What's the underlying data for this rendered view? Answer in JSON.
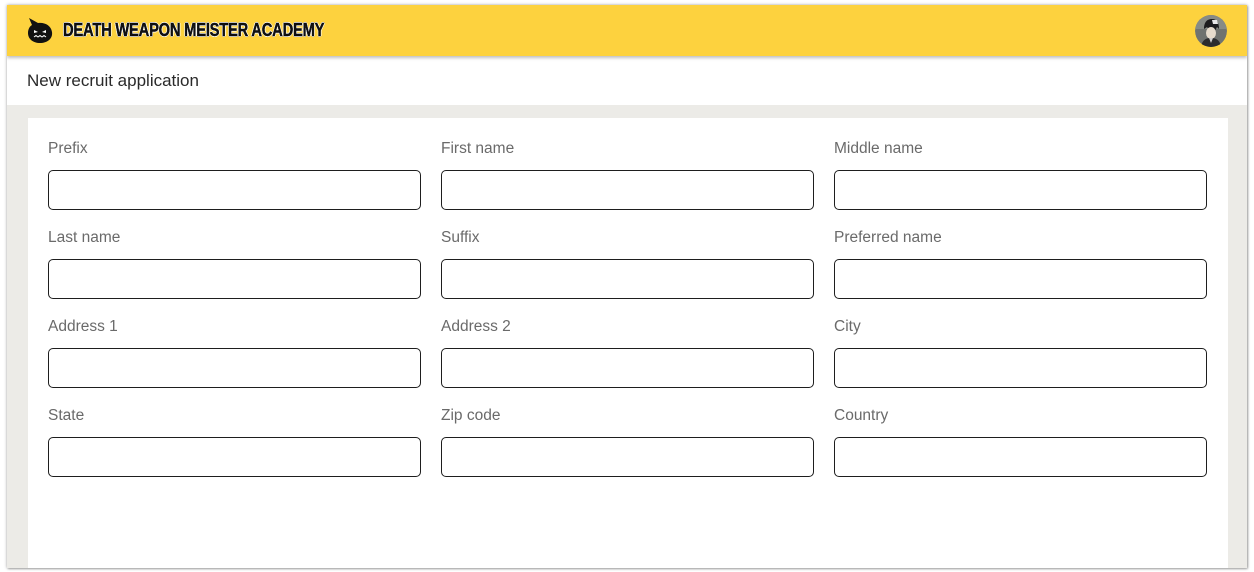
{
  "app": {
    "brand_title": "DEATH WEAPON MEISTER ACADEMY",
    "logo_icon": "skull-mask-icon",
    "avatar_icon": "user-avatar",
    "brand_color": "#fdd23e"
  },
  "page": {
    "title": "New recruit application"
  },
  "form": {
    "fields": [
      {
        "label": "Prefix",
        "value": "",
        "placeholder": ""
      },
      {
        "label": "First name",
        "value": "",
        "placeholder": ""
      },
      {
        "label": "Middle name",
        "value": "",
        "placeholder": ""
      },
      {
        "label": "Last name",
        "value": "",
        "placeholder": ""
      },
      {
        "label": "Suffix",
        "value": "",
        "placeholder": ""
      },
      {
        "label": "Preferred name",
        "value": "",
        "placeholder": ""
      },
      {
        "label": "Address 1",
        "value": "",
        "placeholder": ""
      },
      {
        "label": "Address 2",
        "value": "",
        "placeholder": ""
      },
      {
        "label": "City",
        "value": "",
        "placeholder": ""
      },
      {
        "label": "State",
        "value": "",
        "placeholder": ""
      },
      {
        "label": "Zip code",
        "value": "",
        "placeholder": ""
      },
      {
        "label": "Country",
        "value": "",
        "placeholder": ""
      }
    ]
  }
}
